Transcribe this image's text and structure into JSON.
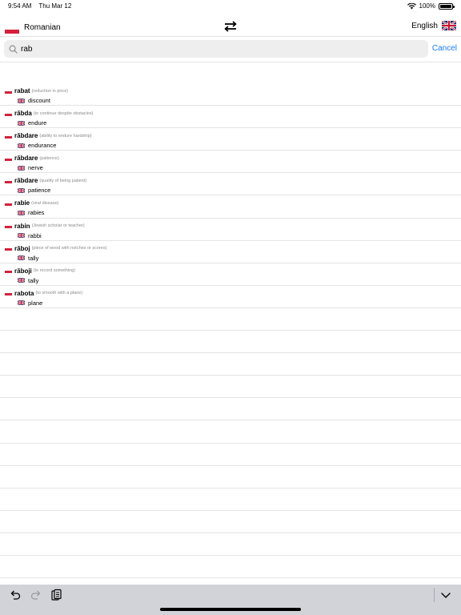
{
  "status_bar": {
    "time": "9:54 AM",
    "date": "Thu Mar 12",
    "battery_text": "100%",
    "battery_level": 1.0
  },
  "header": {
    "source_language": "Romanian",
    "target_language": "English",
    "swap_icon": "swap-arrows-icon"
  },
  "search": {
    "value": "rab",
    "cancel_label": "Cancel"
  },
  "results": [
    {
      "word": "rabat",
      "desc": "(reduction in price)",
      "translation": "discount"
    },
    {
      "word": "răbda",
      "desc": "(to continue despite obstacles)",
      "translation": "endure"
    },
    {
      "word": "răbdare",
      "desc": "(ability to endure hardship)",
      "translation": "endurance"
    },
    {
      "word": "răbdare",
      "desc": "(patience)",
      "translation": "nerve"
    },
    {
      "word": "răbdare",
      "desc": "(quality of being patient)",
      "translation": "patience"
    },
    {
      "word": "rabie",
      "desc": "(viral disease)",
      "translation": "rabies"
    },
    {
      "word": "rabin",
      "desc": "(Jewish scholar or teacher)",
      "translation": "rabbi"
    },
    {
      "word": "răboj",
      "desc": "(piece of wood with notches or scores)",
      "translation": "tally"
    },
    {
      "word": "răboji",
      "desc": "(to record something)",
      "translation": "tally"
    },
    {
      "word": "rabota",
      "desc": "(to smooth with a plane)",
      "translation": "plane"
    }
  ],
  "colors": {
    "accent": "#1a7cf4",
    "poland_red": "#d4213d",
    "toolbar_bg": "#d1d3d9"
  },
  "toolbar": {
    "icons": [
      "undo-icon",
      "redo-icon",
      "paste-icon",
      "chevron-down-icon"
    ]
  }
}
